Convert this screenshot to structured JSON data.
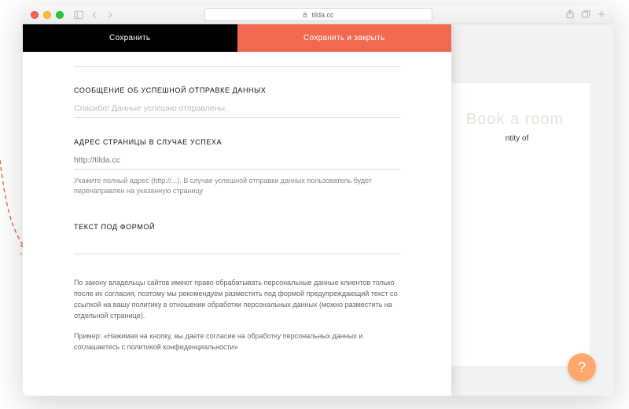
{
  "chrome": {
    "url": "tilda.cc"
  },
  "tabs": {
    "save": "Сохранить",
    "save_close": "Сохранить и закрыть"
  },
  "fields": {
    "success_msg": {
      "label": "СООБЩЕНИЕ ОБ УСПЕШНОЙ ОТПРАВКЕ ДАННЫХ",
      "value": "Спасибо! Данные успешно отправлены."
    },
    "success_url": {
      "label": "АДРЕС СТРАНИЦЫ В СЛУЧАЕ УСПЕХА",
      "placeholder": "http://tilda.cc",
      "help": "Укажите полный адрес (http://...). В случае успешной отправки данных пользователь будет перенаправлен на указанную страницу"
    },
    "under_form_text": {
      "label": "ТЕКСТ ПОД ФОРМОЙ"
    }
  },
  "info": {
    "p1": "По закону владельцы сайтов имеют право обрабатывать персональные данные клиентов только после их согласия, поэтому мы рекомендуем разместить под формой предупреждающий текст со ссылкой на вашу политику в отношении обработки персональных данных (можно разместить на отдельной странице).",
    "p2": "Пример: «Нажимая на кнопку, вы даете согласие на обработку персональных данных и соглашаетесь с политикой конфиденциальности»"
  },
  "preview": {
    "title": "Book a room",
    "subtitle_fragment": "ntity of"
  },
  "help_fab": "?"
}
